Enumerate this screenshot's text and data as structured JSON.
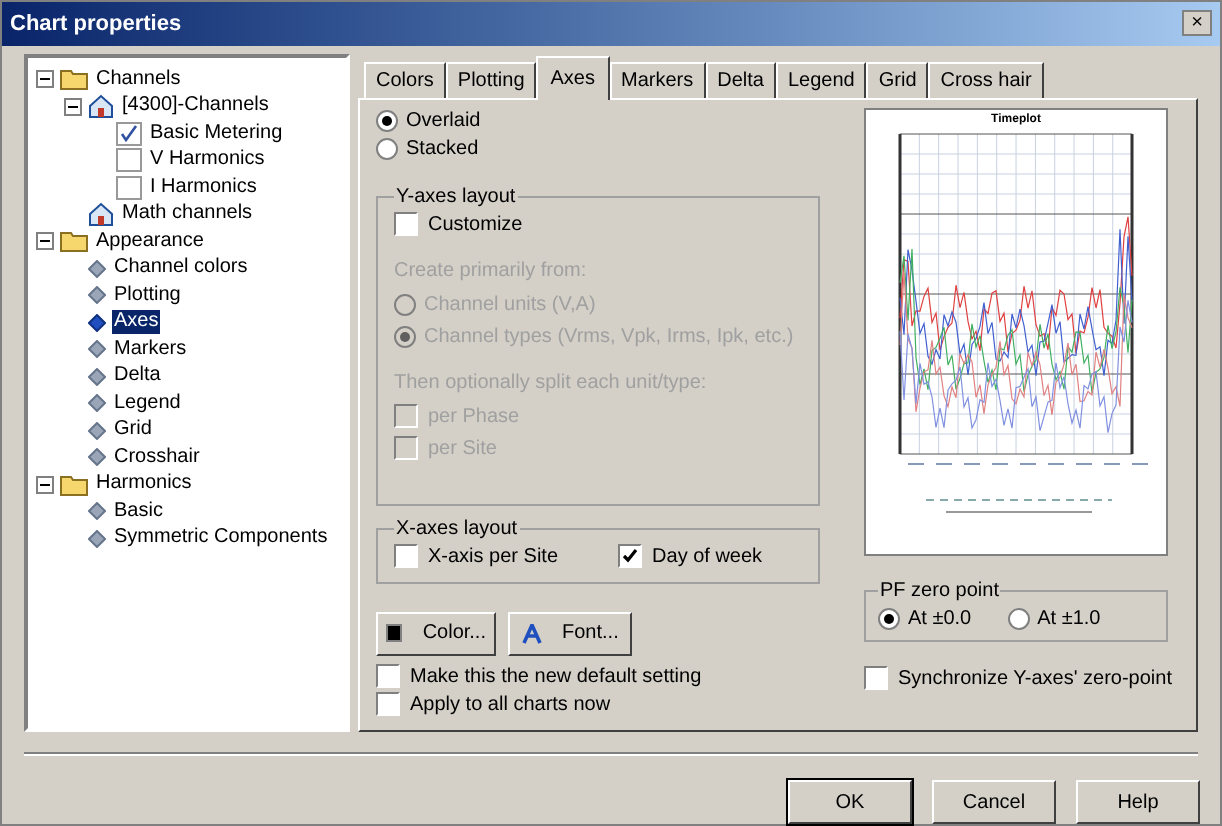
{
  "window": {
    "title": "Chart properties",
    "close": "×"
  },
  "tree": [
    {
      "label": "Channels",
      "kind": "folder",
      "expanded": true,
      "selected": false,
      "children": [
        {
          "label": "[4300]-Channels",
          "kind": "device",
          "expanded": true,
          "selected": false,
          "children": [
            {
              "label": "Basic Metering",
              "kind": "checked-chart",
              "selected": false
            },
            {
              "label": "V Harmonics",
              "kind": "chart",
              "selected": false
            },
            {
              "label": "I Harmonics",
              "kind": "chart",
              "selected": false
            }
          ]
        },
        {
          "label": "Math channels",
          "kind": "device",
          "selected": false
        }
      ]
    },
    {
      "label": "Appearance",
      "kind": "folder",
      "expanded": true,
      "selected": false,
      "children": [
        {
          "label": "Channel colors",
          "kind": "leaf",
          "selected": false
        },
        {
          "label": "Plotting",
          "kind": "leaf",
          "selected": false
        },
        {
          "label": "Axes",
          "kind": "leaf",
          "selected": true
        },
        {
          "label": "Markers",
          "kind": "leaf",
          "selected": false
        },
        {
          "label": "Delta",
          "kind": "leaf",
          "selected": false
        },
        {
          "label": "Legend",
          "kind": "leaf",
          "selected": false
        },
        {
          "label": "Grid",
          "kind": "leaf",
          "selected": false
        },
        {
          "label": "Crosshair",
          "kind": "leaf",
          "selected": false
        }
      ]
    },
    {
      "label": "Harmonics",
      "kind": "folder",
      "expanded": true,
      "selected": false,
      "children": [
        {
          "label": "Basic",
          "kind": "leaf",
          "selected": false
        },
        {
          "label": "Symmetric Components",
          "kind": "leaf",
          "selected": false
        }
      ]
    }
  ],
  "tabs": [
    {
      "label": "Colors",
      "selected": false
    },
    {
      "label": "Plotting",
      "selected": false
    },
    {
      "label": "Axes",
      "selected": true
    },
    {
      "label": "Markers",
      "selected": false
    },
    {
      "label": "Delta",
      "selected": false
    },
    {
      "label": "Legend",
      "selected": false
    },
    {
      "label": "Grid",
      "selected": false
    },
    {
      "label": "Cross hair",
      "selected": false
    }
  ],
  "plot_mode": [
    {
      "label": "Overlaid",
      "selected": true
    },
    {
      "label": "Stacked",
      "selected": false
    }
  ],
  "y_axes_layout": {
    "title": "Y-axes layout",
    "customize": {
      "label": "Customize",
      "checked": false
    },
    "create_label": "Create primarily from:",
    "create_disabled": true,
    "create_options": [
      {
        "label": "Channel units (V,A)",
        "selected": false
      },
      {
        "label": "Channel types (Vrms, Vpk, Irms, Ipk, etc.)",
        "selected": true
      }
    ],
    "split_label": "Then optionally split each unit/type:",
    "split_options": [
      {
        "label": "per Phase",
        "checked": false
      },
      {
        "label": "per Site",
        "checked": false
      }
    ]
  },
  "x_axes_layout": {
    "title": "X-axes layout",
    "options": [
      {
        "label": "X-axis per Site",
        "checked": false
      },
      {
        "label": "Day of week",
        "checked": true
      }
    ]
  },
  "preview": {
    "title": "Timeplot"
  },
  "color_button": "Color...",
  "font_button": "Font...",
  "default_options": [
    {
      "label": "Make this the new default setting",
      "checked": false
    },
    {
      "label": "Apply to all charts now",
      "checked": false
    }
  ],
  "pf_zero_point": {
    "title": "PF zero point",
    "options": [
      {
        "label": "At ±0.0",
        "selected": true
      },
      {
        "label": "At ±1.0",
        "selected": false
      }
    ]
  },
  "synchronize": {
    "label": "Synchronize Y-axes' zero-point",
    "checked": false
  },
  "buttons": [
    {
      "label": "OK",
      "default": true
    },
    {
      "label": "Cancel",
      "default": false
    },
    {
      "label": "Help",
      "default": false
    }
  ]
}
